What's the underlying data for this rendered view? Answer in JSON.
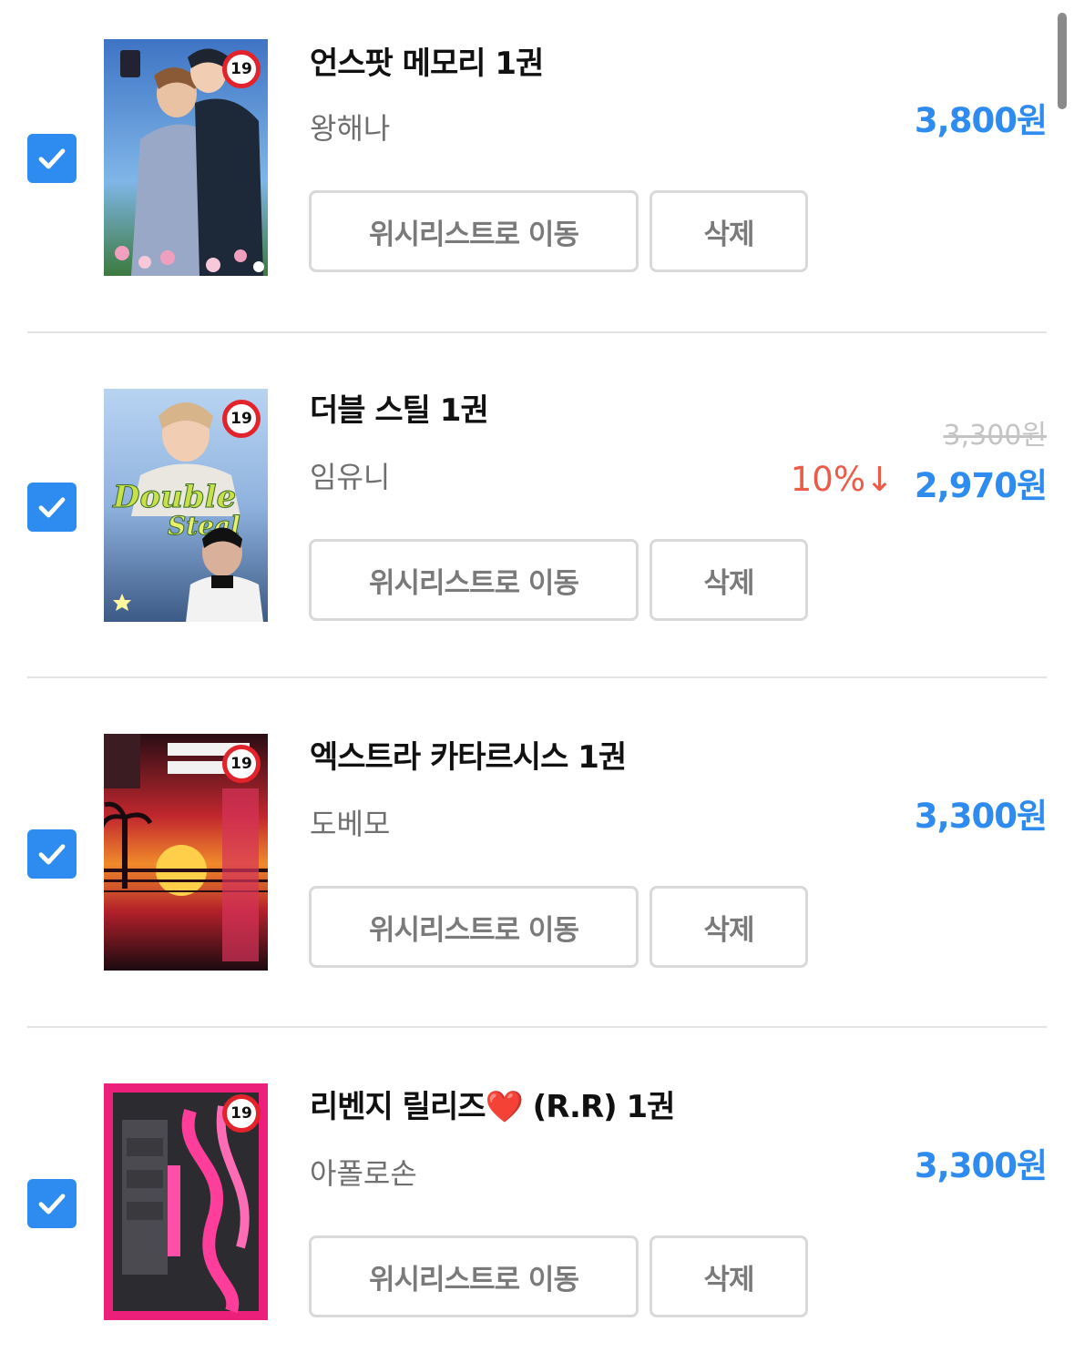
{
  "items": [
    {
      "title": "언스팟 메모리 1권",
      "author": "왕해나",
      "price": "3,800원",
      "checked": true,
      "age_badge": "19",
      "wishlist_label": "위시리스트로 이동",
      "delete_label": "삭제"
    },
    {
      "title": "더블 스틸 1권",
      "author": "임유니",
      "original_price": "3,300원",
      "discount": "10%↓",
      "price": "2,970원",
      "checked": true,
      "age_badge": "19",
      "wishlist_label": "위시리스트로 이동",
      "delete_label": "삭제"
    },
    {
      "title": "엑스트라 카타르시스 1권",
      "author": "도베모",
      "price": "3,300원",
      "checked": true,
      "age_badge": "19",
      "wishlist_label": "위시리스트로 이동",
      "delete_label": "삭제"
    },
    {
      "title": "리벤지 릴리즈❤️ (R.R) 1권",
      "author": "아폴로손",
      "price": "3,300원",
      "checked": true,
      "age_badge": "19",
      "wishlist_label": "위시리스트로 이동",
      "delete_label": "삭제"
    }
  ],
  "colors": {
    "accent": "#2e8bef",
    "discount": "#ec5a48",
    "author": "#6f6f6f",
    "button_border": "#d9d9d9"
  }
}
